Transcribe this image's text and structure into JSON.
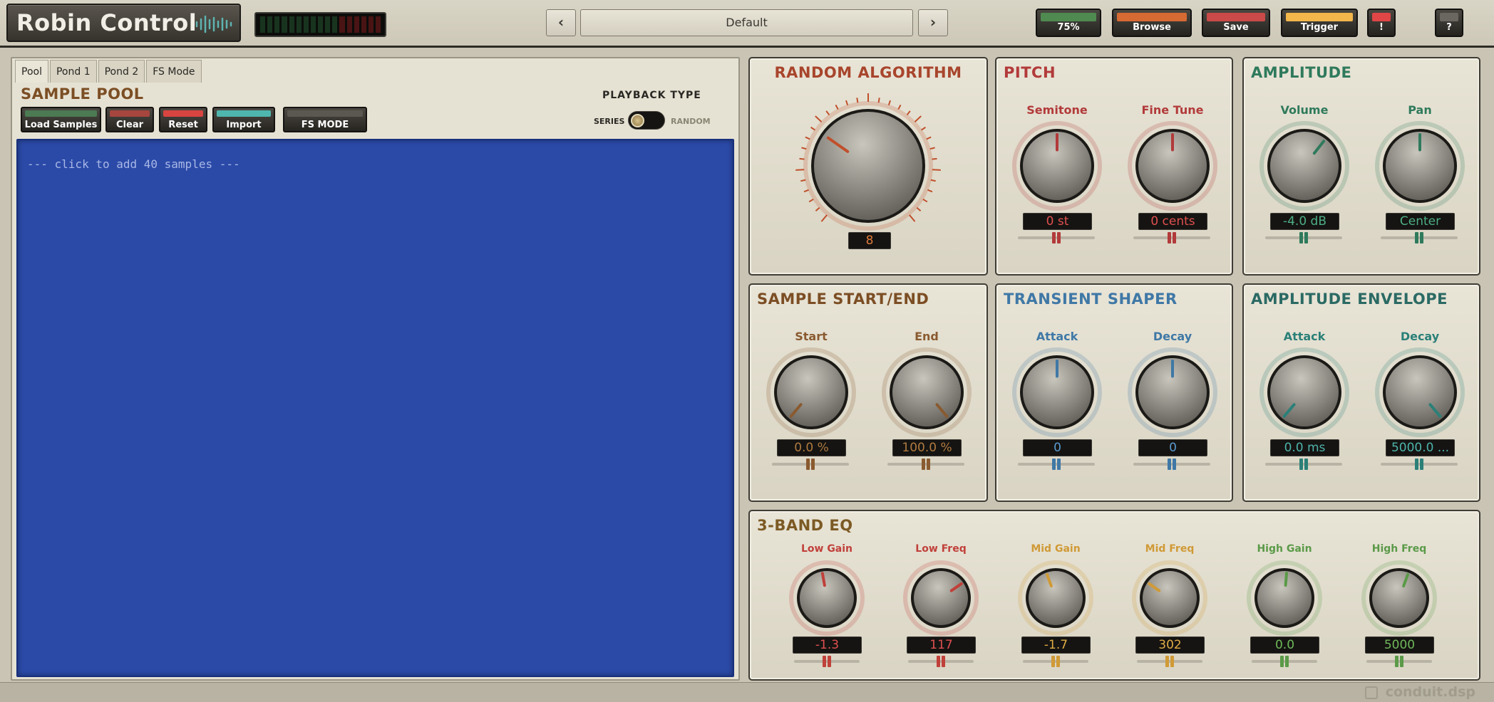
{
  "header": {
    "app_title": "Robin Control",
    "prev_label": "‹",
    "next_label": "›",
    "preset_name": "Default",
    "buttons": [
      {
        "id": "zoom",
        "label": "75%",
        "led": "#4f8a50"
      },
      {
        "id": "browse",
        "label": "Browse",
        "led": "#d66a33"
      },
      {
        "id": "save",
        "label": "Save",
        "led": "#c94a48"
      },
      {
        "id": "trigger",
        "label": "Trigger",
        "led": "#f2b64a"
      },
      {
        "id": "alert",
        "label": "!",
        "led": "#e04646"
      },
      {
        "id": "help",
        "label": "?",
        "led": "#6a6760"
      }
    ]
  },
  "pool": {
    "tabs": [
      "Pool",
      "Pond 1",
      "Pond 2",
      "FS Mode"
    ],
    "active_tab": "Pool",
    "title": "SAMPLE POOL",
    "buttons": [
      {
        "label": "Load Samples",
        "led": "#4c7a52"
      },
      {
        "label": "Clear",
        "led": "#a6463e"
      },
      {
        "label": "Reset",
        "led": "#d84440"
      },
      {
        "label": "Import",
        "led": "#4fb6ae"
      },
      {
        "label": "FS MODE",
        "led": "#5b5852"
      }
    ],
    "playback_type": "PLAYBACK TYPE",
    "series_label": "SERIES",
    "random_label": "RANDOM",
    "playback_mode": "SERIES",
    "empty_text": "--- click to add 40 samples ---"
  },
  "random_algorithm": {
    "title": "RANDOM ALGORITHM",
    "value": "8",
    "color": "#c0502c"
  },
  "pitch": {
    "title": "PITCH",
    "color": "#b23a3a",
    "knobs": [
      {
        "label": "Semitone",
        "value": "0 st"
      },
      {
        "label": "Fine Tune",
        "value": "0 cents"
      }
    ]
  },
  "amplitude": {
    "title": "AMPLITUDE",
    "color": "#2f7a5c",
    "knobs": [
      {
        "label": "Volume",
        "value": "-4.0 dB"
      },
      {
        "label": "Pan",
        "value": "Center"
      }
    ]
  },
  "sample_start_end": {
    "title": "SAMPLE START/END",
    "color": "#8a5a30",
    "knobs": [
      {
        "label": "Start",
        "value": "0.0 %"
      },
      {
        "label": "End",
        "value": "100.0 %"
      }
    ]
  },
  "transient_shaper": {
    "title": "TRANSIENT SHAPER",
    "color": "#3f78a6",
    "knobs": [
      {
        "label": "Attack",
        "value": "0"
      },
      {
        "label": "Decay",
        "value": "0"
      }
    ]
  },
  "amplitude_envelope": {
    "title": "AMPLITUDE ENVELOPE",
    "color": "#2b8078",
    "knobs": [
      {
        "label": "Attack",
        "value": "0.0 ms"
      },
      {
        "label": "Decay",
        "value": "5000.0 ..."
      }
    ]
  },
  "eq": {
    "title": "3-BAND EQ",
    "knobs": [
      {
        "label": "Low Gain",
        "value": "-1.3",
        "color": "#c0403a"
      },
      {
        "label": "Low Freq",
        "value": "117",
        "color": "#c0403a"
      },
      {
        "label": "Mid Gain",
        "value": "-1.7",
        "color": "#d09a36"
      },
      {
        "label": "Mid Freq",
        "value": "302",
        "color": "#d09a36"
      },
      {
        "label": "High Gain",
        "value": "0.0",
        "color": "#5a9a48"
      },
      {
        "label": "High Freq",
        "value": "5000",
        "color": "#5a9a48"
      }
    ]
  },
  "footer": {
    "brand": "conduit.dsp"
  }
}
